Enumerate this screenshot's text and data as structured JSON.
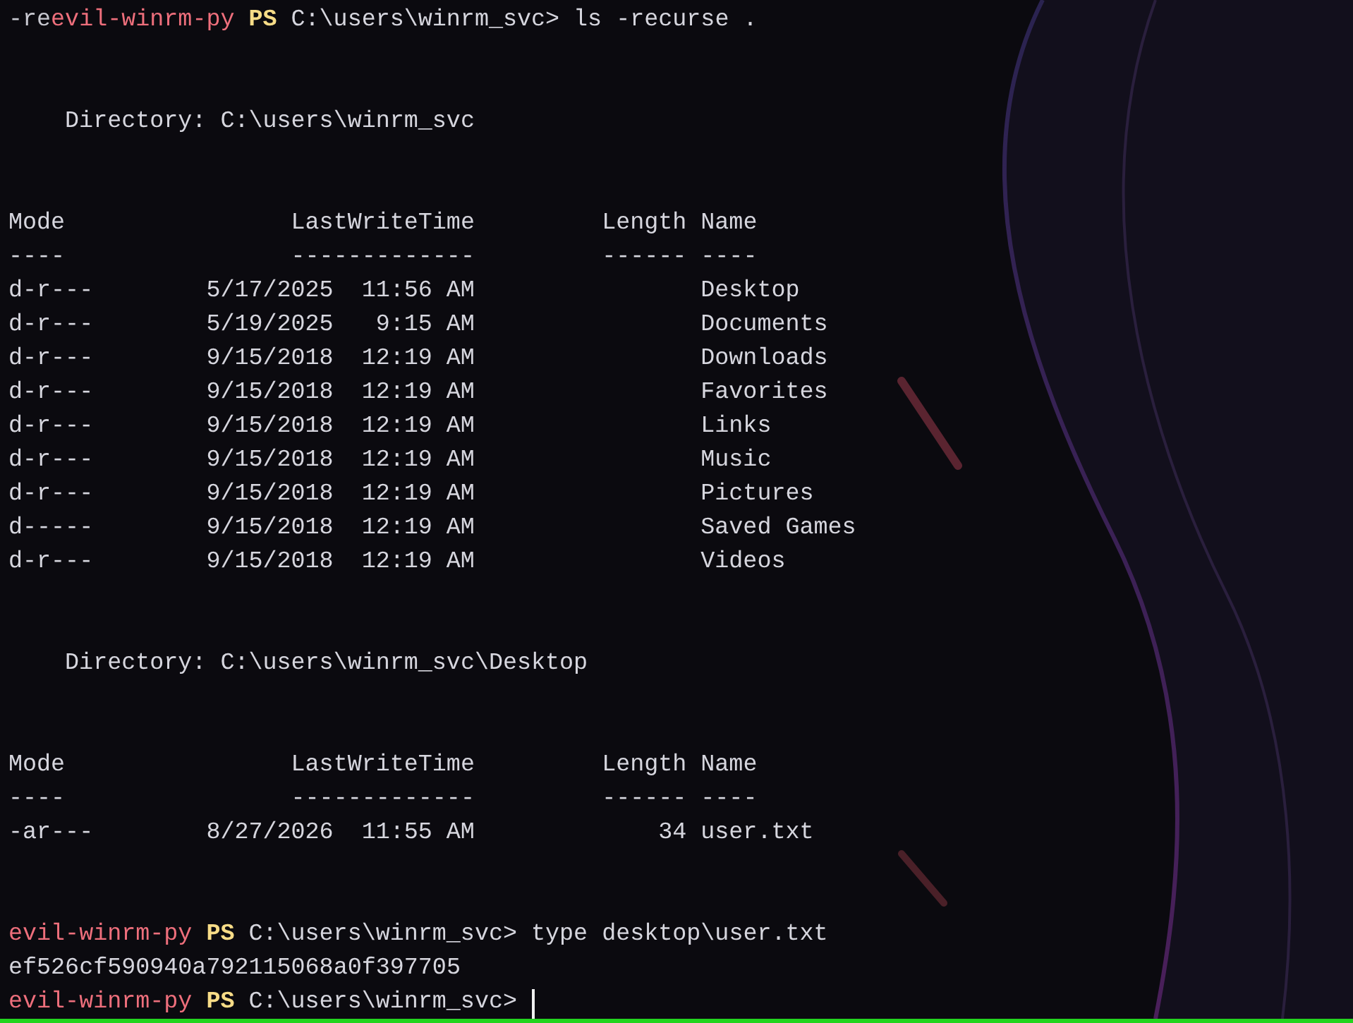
{
  "terminal": {
    "lines": [
      {
        "kind": "prompt",
        "prefix": "-re",
        "host": "evil-winrm-py",
        "shell": "PS",
        "path": "C:\\users\\winrm_svc>",
        "command": "ls -recurse .",
        "cursor": false
      },
      {
        "kind": "blank"
      },
      {
        "kind": "blank"
      },
      {
        "kind": "directory",
        "label": "Directory:",
        "path": "C:\\users\\winrm_svc"
      },
      {
        "kind": "blank"
      },
      {
        "kind": "blank"
      },
      {
        "kind": "header",
        "mode": "Mode",
        "time": "LastWriteTime",
        "length": "Length",
        "name": "Name"
      },
      {
        "kind": "separator",
        "mode": "----",
        "time": "-------------",
        "length": "------",
        "name": "----"
      },
      {
        "kind": "entry",
        "mode": "d-r---",
        "date": "5/17/2025",
        "time": "11:56 AM",
        "name": "Desktop"
      },
      {
        "kind": "entry",
        "mode": "d-r---",
        "date": "5/19/2025",
        "time": "9:15 AM",
        "name": "Documents"
      },
      {
        "kind": "entry",
        "mode": "d-r---",
        "date": "9/15/2018",
        "time": "12:19 AM",
        "name": "Downloads"
      },
      {
        "kind": "entry",
        "mode": "d-r---",
        "date": "9/15/2018",
        "time": "12:19 AM",
        "name": "Favorites"
      },
      {
        "kind": "entry",
        "mode": "d-r---",
        "date": "9/15/2018",
        "time": "12:19 AM",
        "name": "Links"
      },
      {
        "kind": "entry",
        "mode": "d-r---",
        "date": "9/15/2018",
        "time": "12:19 AM",
        "name": "Music"
      },
      {
        "kind": "entry",
        "mode": "d-r---",
        "date": "9/15/2018",
        "time": "12:19 AM",
        "name": "Pictures"
      },
      {
        "kind": "entry",
        "mode": "d-----",
        "date": "9/15/2018",
        "time": "12:19 AM",
        "name": "Saved Games"
      },
      {
        "kind": "entry",
        "mode": "d-r---",
        "date": "9/15/2018",
        "time": "12:19 AM",
        "name": "Videos"
      },
      {
        "kind": "blank"
      },
      {
        "kind": "blank"
      },
      {
        "kind": "directory",
        "label": "Directory:",
        "path": "C:\\users\\winrm_svc\\Desktop"
      },
      {
        "kind": "blank"
      },
      {
        "kind": "blank"
      },
      {
        "kind": "header",
        "mode": "Mode",
        "time": "LastWriteTime",
        "length": "Length",
        "name": "Name"
      },
      {
        "kind": "separator",
        "mode": "----",
        "time": "-------------",
        "length": "------",
        "name": "----"
      },
      {
        "kind": "entry",
        "mode": "-ar---",
        "date": "8/27/2026",
        "time": "11:55 AM",
        "length": "34",
        "name": "user.txt"
      },
      {
        "kind": "blank"
      },
      {
        "kind": "blank"
      },
      {
        "kind": "prompt",
        "host": "evil-winrm-py",
        "shell": "PS",
        "path": "C:\\users\\winrm_svc>",
        "command": "type desktop\\user.txt",
        "cursor": false
      },
      {
        "kind": "output",
        "text": "ef526cf590940a792115068a0f397705"
      },
      {
        "kind": "prompt",
        "host": "evil-winrm-py",
        "shell": "PS",
        "path": "C:\\users\\winrm_svc>",
        "cursor": true
      }
    ]
  }
}
